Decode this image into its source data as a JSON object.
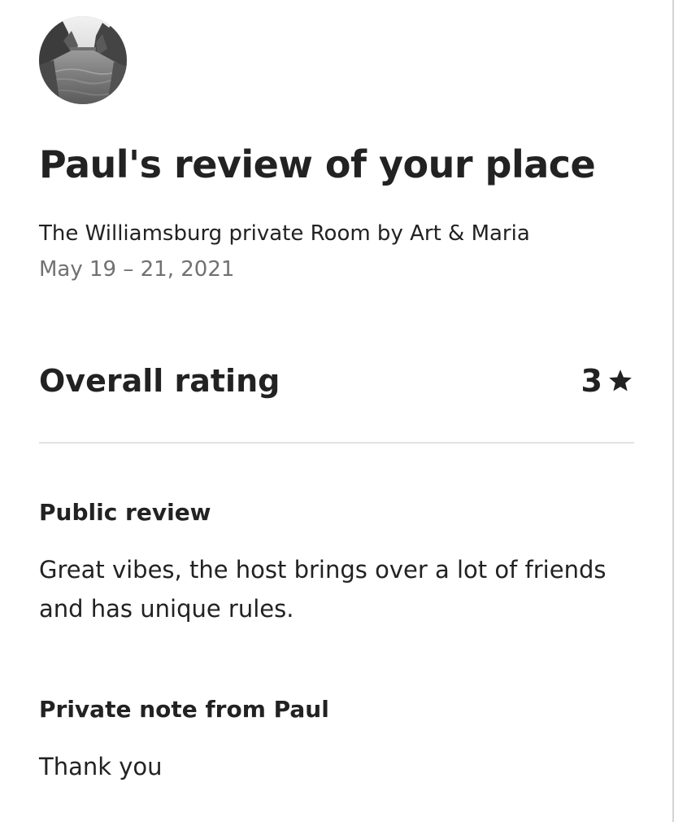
{
  "review": {
    "title": "Paul's review of your place",
    "listing_name": "The Williamsburg private Room by Art & Maria",
    "stay_dates": "May 19 – 21, 2021"
  },
  "overall_rating": {
    "label": "Overall rating",
    "value": "3",
    "icon": "star-icon"
  },
  "public_review": {
    "heading": "Public review",
    "text": "Great vibes, the host brings over a lot of friends and has unique rules."
  },
  "private_note": {
    "heading": "Private note from Paul",
    "text": "Thank you"
  },
  "colors": {
    "text_primary": "#222222",
    "text_secondary": "#717171",
    "divider": "#e2e2e2"
  }
}
